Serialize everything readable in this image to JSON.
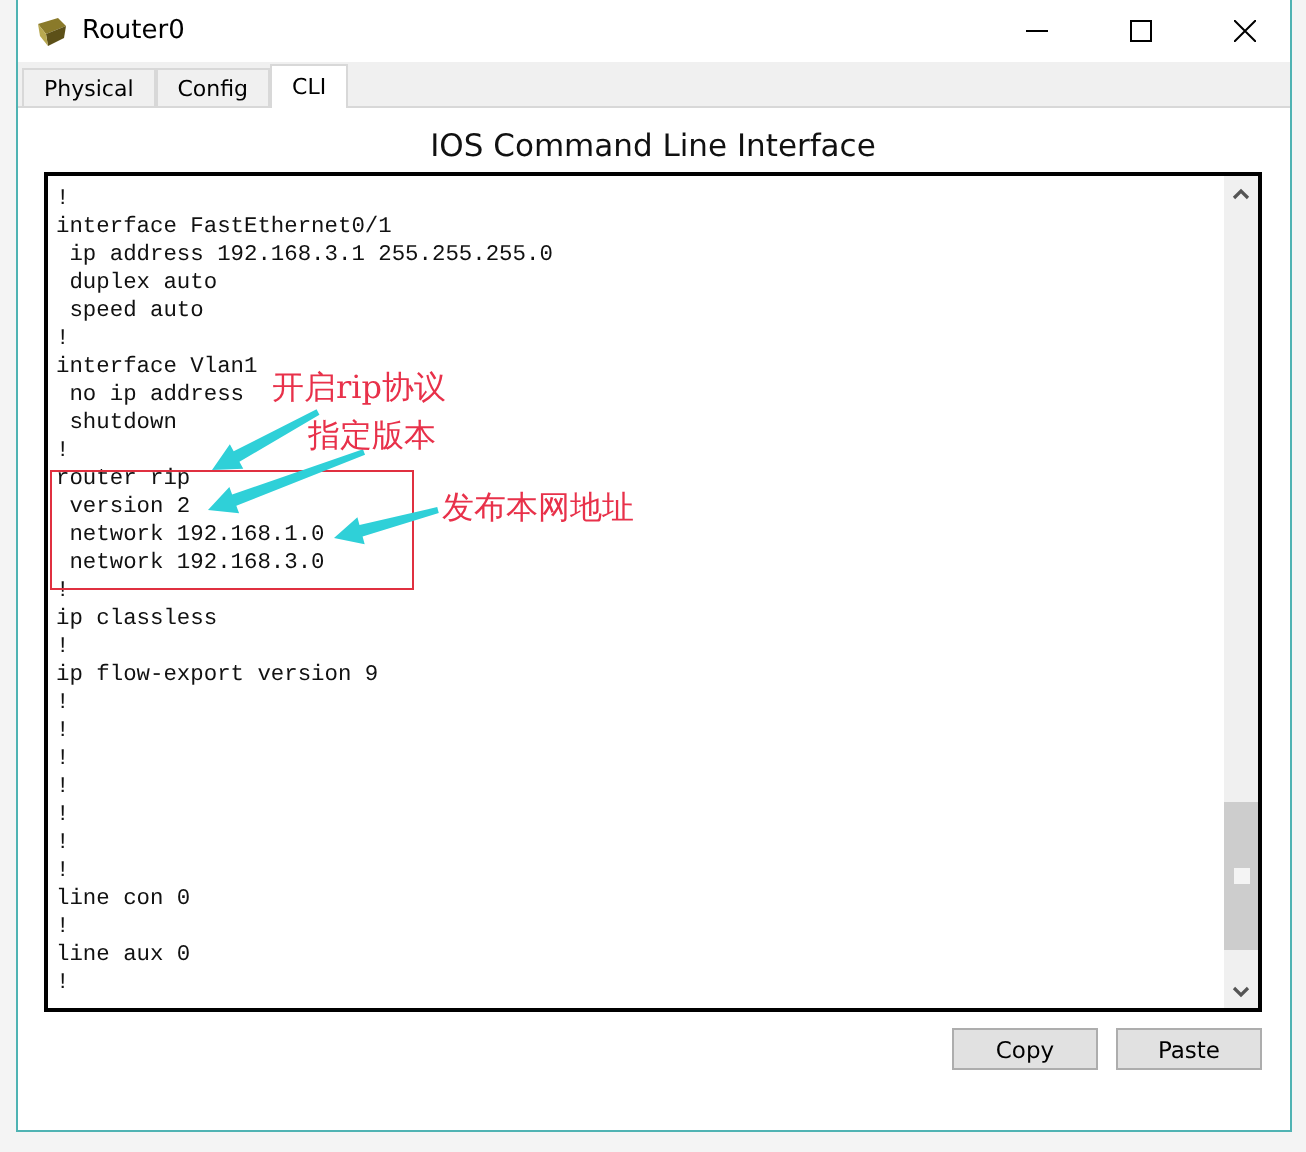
{
  "window": {
    "title": "Router0"
  },
  "tabs": [
    {
      "label": "Physical",
      "selected": false
    },
    {
      "label": "Config",
      "selected": false
    },
    {
      "label": "CLI",
      "selected": true
    }
  ],
  "heading": "IOS Command Line Interface",
  "terminal_lines": [
    "!",
    "interface FastEthernet0/1",
    " ip address 192.168.3.1 255.255.255.0",
    " duplex auto",
    " speed auto",
    "!",
    "interface Vlan1",
    " no ip address",
    " shutdown",
    "!",
    "router rip",
    " version 2",
    " network 192.168.1.0",
    " network 192.168.3.0",
    "!",
    "ip classless",
    "!",
    "ip flow-export version 9",
    "!",
    "!",
    "!",
    "!",
    "!",
    "!",
    "!",
    "line con 0",
    "!",
    "line aux 0",
    "!"
  ],
  "annotations": [
    {
      "text": "开启rip协议"
    },
    {
      "text": "指定版本"
    },
    {
      "text": "发布本网地址"
    }
  ],
  "buttons": [
    "Copy",
    "Paste"
  ]
}
